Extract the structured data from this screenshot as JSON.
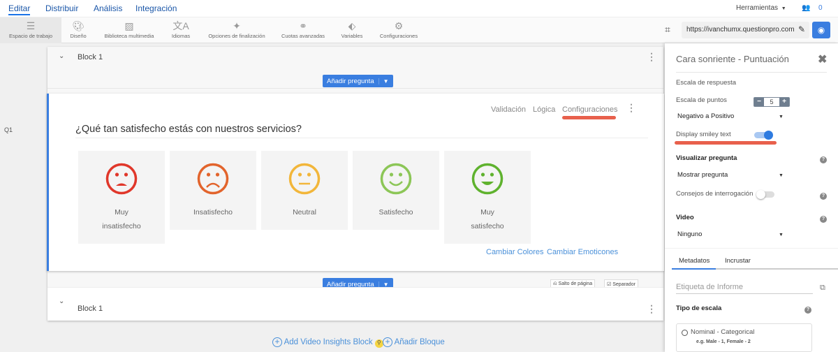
{
  "nav": {
    "tabs": [
      "Editar",
      "Distribuir",
      "Análisis",
      "Integración"
    ],
    "tools_label": "Herramientas",
    "collab_count": "0"
  },
  "toolbar": {
    "items": [
      {
        "label": "Espacio de trabajo",
        "icon": "workspace-icon"
      },
      {
        "label": "Diseño",
        "icon": "palette-icon"
      },
      {
        "label": "Biblioteca multimedia",
        "icon": "image-icon"
      },
      {
        "label": "Idiomas",
        "icon": "language-icon"
      },
      {
        "label": "Opciones de finalización",
        "icon": "magic-wand-icon"
      },
      {
        "label": "Cuotas avanzadas",
        "icon": "quota-icon"
      },
      {
        "label": "Variables",
        "icon": "tag-icon"
      },
      {
        "label": "Configuraciones",
        "icon": "gear-icon"
      }
    ],
    "url": "https://ivanchumx.questionpro.com"
  },
  "editor": {
    "block_title": "Block 1",
    "add_question": "Añadir pregunta",
    "question_number": "Q1",
    "question_tabs": [
      "Validación",
      "Lógica",
      "Configuraciones"
    ],
    "question_text": "¿Qué tan satisfecho estás con nuestros servicios?",
    "options": [
      {
        "line1": "Muy",
        "line2": "insatisfecho",
        "color": "#e0372a"
      },
      {
        "line1": "Insatisfecho",
        "line2": "",
        "color": "#e2642c"
      },
      {
        "line1": "Neutral",
        "line2": "",
        "color": "#f2b63a"
      },
      {
        "line1": "Satisfecho",
        "line2": "",
        "color": "#8cc657"
      },
      {
        "line1": "Muy",
        "line2": "satisfecho",
        "color": "#5fb22e"
      }
    ],
    "change_colors": "Cambiar Colores",
    "change_emoticons": "Cambiar Emoticones",
    "page_break": "Salto de página",
    "separator": "Separador",
    "add_video_block": "Add Video Insights Block",
    "add_block": "Añadir Bloque"
  },
  "panel": {
    "title": "Cara sonriente - Puntuación",
    "response_scale": "Escala de respuesta",
    "points_scale": "Escala de puntos",
    "points_value": "5",
    "direction": "Negativo a Positivo",
    "display_smiley_text": "Display smiley text",
    "display_smiley_on": true,
    "view_question": "Visualizar pregunta",
    "view_question_value": "Mostrar pregunta",
    "tips": "Consejos de interrogación",
    "tips_on": false,
    "video": "Video",
    "video_value": "Ninguno",
    "tabs": [
      "Metadatos",
      "Incrustar"
    ],
    "report_label_placeholder": "Etiqueta de Informe",
    "scale_type": "Tipo de escala",
    "nominal": "Nominal - Categorical",
    "nominal_example": "e.g. Male - 1, Female - 2"
  }
}
